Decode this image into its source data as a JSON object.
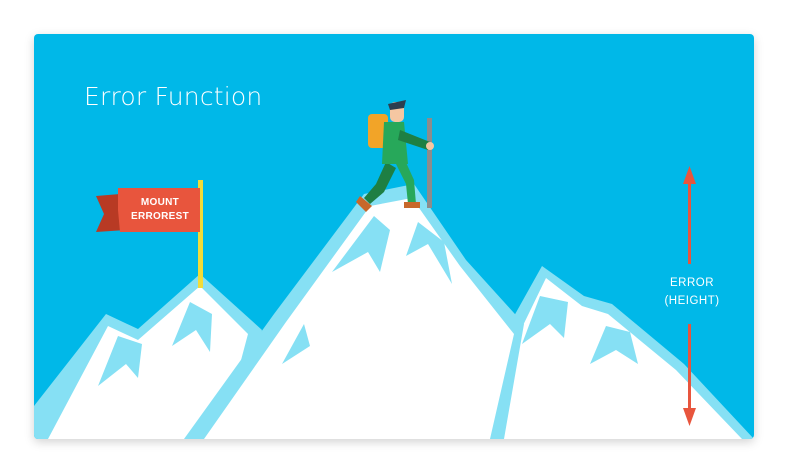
{
  "title": "Error Function",
  "flag": {
    "line1": "MOUNT",
    "line2": "ERROREST"
  },
  "error_label": {
    "line1": "ERROR",
    "line2": "(HEIGHT)"
  },
  "colors": {
    "sky": "#00B8E8",
    "snow": "#FFFFFF",
    "snow_shade": "#86E0F4",
    "flag_red": "#E8553D",
    "flag_dark": "#B83A24",
    "pole": "#F2DC38",
    "arrow": "#E8553D",
    "text": "#FFFFFF",
    "hiker_body": "#27A85A",
    "hiker_dark": "#1E7F43",
    "backpack": "#F2A428",
    "skin": "#F5C7A2",
    "hair": "#2C3E50",
    "stick": "#8C8C8C",
    "boot": "#C8682B"
  },
  "icons": [
    "mountain-range",
    "hiker",
    "flag",
    "double-arrow"
  ]
}
